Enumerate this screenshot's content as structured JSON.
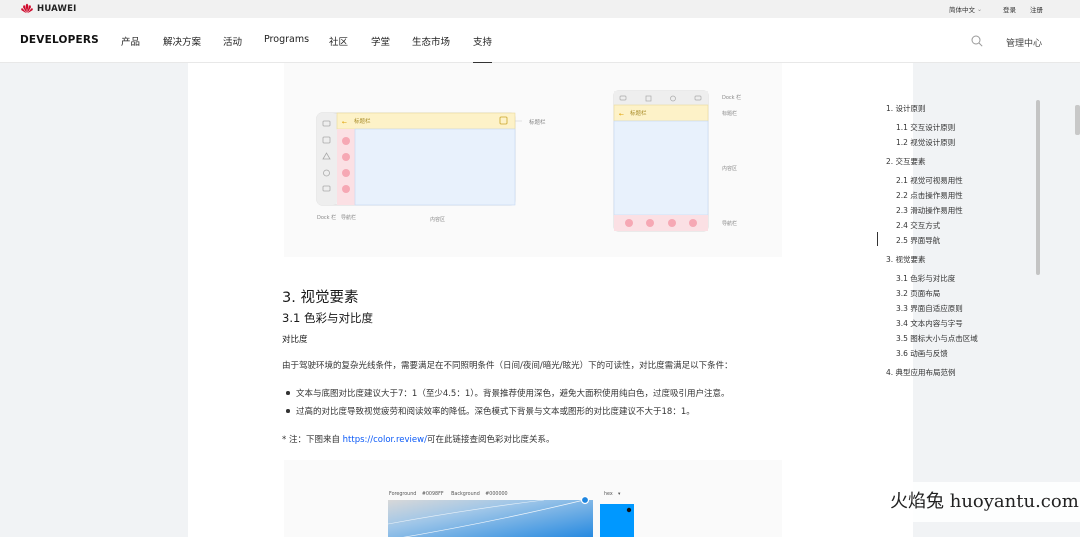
{
  "topbar": {
    "logo_text": "HUAWEI",
    "language": "简体中文",
    "login": "登录",
    "register": "注册"
  },
  "nav": {
    "brand": "DEVELOPERS",
    "items": [
      "产品",
      "解决方案",
      "活动",
      "Programs",
      "社区",
      "学堂",
      "生态市场",
      "支持"
    ],
    "active_index": 7,
    "management": "管理中心",
    "search_icon": "search-icon"
  },
  "figure1": {
    "landscape_title": "标题栏",
    "landscape_title_label": "标题栏",
    "dock_label": "Dock 栏",
    "nav_label": "导航栏",
    "content_label": "内容区",
    "portrait_dock_label": "Dock 栏",
    "portrait_title": "标题栏",
    "portrait_title_label": "标题栏",
    "portrait_content_label": "内容区",
    "portrait_nav_label": "导航栏"
  },
  "article": {
    "h3": "3. 视觉要素",
    "h4": "3.1 色彩与对比度",
    "label": "对比度",
    "para": "由于驾驶环境的复杂光线条件，需要满足在不同照明条件（日间/夜间/暗光/眩光）下的可读性，对比度需满足以下条件：",
    "bullets": [
      "文本与底图对比度建议大于7：1（至少4.5：1）。背景推荐使用深色，避免大面积使用纯白色，过度吸引用户注意。",
      "过高的对比度导致视觉疲劳和阅读效率的降低。深色模式下背景与文本或图形的对比度建议不大于18：1。"
    ],
    "note_prefix": "* 注：下图来自 ",
    "note_link": "https://color.review/",
    "note_suffix": "可在此链接查阅色彩对比度关系。"
  },
  "figure2": {
    "foreground": "Foreground",
    "foreground_value": "#0098FF",
    "background": "Background",
    "background_value": "#000000",
    "mode": "hex"
  },
  "toc": [
    {
      "text": "1. 设计原则",
      "level": 1
    },
    {
      "text": "1.1 交互设计原则",
      "level": 2
    },
    {
      "text": "1.2 视觉设计原则",
      "level": 2
    },
    {
      "text": "2. 交互要素",
      "level": 1
    },
    {
      "text": "2.1 视觉可视易用性",
      "level": 2
    },
    {
      "text": "2.2 点击操作易用性",
      "level": 2
    },
    {
      "text": "2.3 滑动操作易用性",
      "level": 2
    },
    {
      "text": "2.4 交互方式",
      "level": 2
    },
    {
      "text": "2.5 界面导航",
      "level": 2
    },
    {
      "text": "3. 视觉要素",
      "level": 1
    },
    {
      "text": "3.1 色彩与对比度",
      "level": 2
    },
    {
      "text": "3.2 页面布局",
      "level": 2
    },
    {
      "text": "3.3 界面自适应原则",
      "level": 2
    },
    {
      "text": "3.4 文本内容与字号",
      "level": 2
    },
    {
      "text": "3.5 图标大小与点击区域",
      "level": 2
    },
    {
      "text": "3.6 动画与反馈",
      "level": 2
    },
    {
      "text": "4. 典型应用布局范例",
      "level": 1
    }
  ],
  "watermark": "火焰兔 huoyantu.com",
  "colors": {
    "accent_link": "#0a59f7",
    "huawei_red": "#cf0a2c",
    "title_bar_yellow": "#fdf2c8",
    "content_blue": "#e8f1fc",
    "nav_pink": "#f6a8b4",
    "foreground_blue": "#0098ff"
  }
}
